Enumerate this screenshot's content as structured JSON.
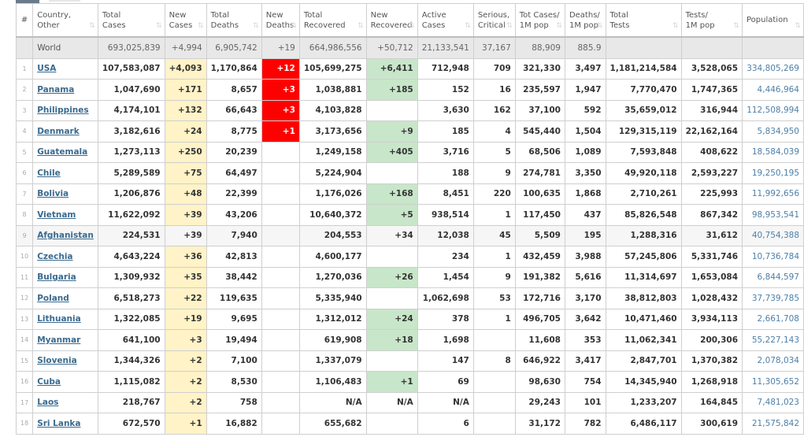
{
  "table": {
    "headers": [
      {
        "line1": "#",
        "line2": ""
      },
      {
        "line1": "Country,",
        "line2": "Other"
      },
      {
        "line1": "Total",
        "line2": "Cases"
      },
      {
        "line1": "New",
        "line2": "Cases"
      },
      {
        "line1": "Total",
        "line2": "Deaths"
      },
      {
        "line1": "New",
        "line2": "Deaths"
      },
      {
        "line1": "Total",
        "line2": "Recovered"
      },
      {
        "line1": "New",
        "line2": "Recovered"
      },
      {
        "line1": "Active",
        "line2": "Cases"
      },
      {
        "line1": "Serious,",
        "line2": "Critical"
      },
      {
        "line1": "Tot Cases/",
        "line2": "1M pop"
      },
      {
        "line1": "Deaths/",
        "line2": "1M pop"
      },
      {
        "line1": "Total",
        "line2": "Tests"
      },
      {
        "line1": "Tests/",
        "line2": "1M pop"
      },
      {
        "line1": "",
        "line2": "Population"
      }
    ],
    "sort_icon": "⇅",
    "world": {
      "country": "World",
      "total_cases": "693,025,839",
      "new_cases": "+4,994",
      "total_deaths": "6,905,742",
      "new_deaths": "+19",
      "total_recovered": "664,986,556",
      "new_recovered": "+50,712",
      "active_cases": "21,133,541",
      "serious": "37,167",
      "cases_per_m": "88,909",
      "deaths_per_m": "885.9",
      "total_tests": "",
      "tests_per_m": "",
      "population": ""
    },
    "rows": [
      {
        "idx": "1",
        "country": "USA",
        "total_cases": "107,583,087",
        "new_cases": "+4,093",
        "total_deaths": "1,170,864",
        "new_deaths": "+12",
        "total_recovered": "105,699,275",
        "new_recovered": "+6,411",
        "active_cases": "712,948",
        "serious": "709",
        "cases_per_m": "321,330",
        "deaths_per_m": "3,497",
        "total_tests": "1,181,214,584",
        "tests_per_m": "3,528,065",
        "population": "334,805,269"
      },
      {
        "idx": "2",
        "country": "Panama",
        "total_cases": "1,047,690",
        "new_cases": "+171",
        "total_deaths": "8,657",
        "new_deaths": "+3",
        "total_recovered": "1,038,881",
        "new_recovered": "+185",
        "active_cases": "152",
        "serious": "16",
        "cases_per_m": "235,597",
        "deaths_per_m": "1,947",
        "total_tests": "7,770,470",
        "tests_per_m": "1,747,365",
        "population": "4,446,964"
      },
      {
        "idx": "3",
        "country": "Philippines",
        "total_cases": "4,174,101",
        "new_cases": "+132",
        "total_deaths": "66,643",
        "new_deaths": "+3",
        "total_recovered": "4,103,828",
        "new_recovered": "",
        "active_cases": "3,630",
        "serious": "162",
        "cases_per_m": "37,100",
        "deaths_per_m": "592",
        "total_tests": "35,659,012",
        "tests_per_m": "316,944",
        "population": "112,508,994"
      },
      {
        "idx": "4",
        "country": "Denmark",
        "total_cases": "3,182,616",
        "new_cases": "+24",
        "total_deaths": "8,775",
        "new_deaths": "+1",
        "total_recovered": "3,173,656",
        "new_recovered": "+9",
        "active_cases": "185",
        "serious": "4",
        "cases_per_m": "545,440",
        "deaths_per_m": "1,504",
        "total_tests": "129,315,119",
        "tests_per_m": "22,162,164",
        "population": "5,834,950"
      },
      {
        "idx": "5",
        "country": "Guatemala",
        "total_cases": "1,273,113",
        "new_cases": "+250",
        "total_deaths": "20,239",
        "new_deaths": "",
        "total_recovered": "1,249,158",
        "new_recovered": "+405",
        "active_cases": "3,716",
        "serious": "5",
        "cases_per_m": "68,506",
        "deaths_per_m": "1,089",
        "total_tests": "7,593,848",
        "tests_per_m": "408,622",
        "population": "18,584,039"
      },
      {
        "idx": "6",
        "country": "Chile",
        "total_cases": "5,289,589",
        "new_cases": "+75",
        "total_deaths": "64,497",
        "new_deaths": "",
        "total_recovered": "5,224,904",
        "new_recovered": "",
        "active_cases": "188",
        "serious": "9",
        "cases_per_m": "274,781",
        "deaths_per_m": "3,350",
        "total_tests": "49,920,118",
        "tests_per_m": "2,593,227",
        "population": "19,250,195"
      },
      {
        "idx": "7",
        "country": "Bolivia",
        "total_cases": "1,206,876",
        "new_cases": "+48",
        "total_deaths": "22,399",
        "new_deaths": "",
        "total_recovered": "1,176,026",
        "new_recovered": "+168",
        "active_cases": "8,451",
        "serious": "220",
        "cases_per_m": "100,635",
        "deaths_per_m": "1,868",
        "total_tests": "2,710,261",
        "tests_per_m": "225,993",
        "population": "11,992,656"
      },
      {
        "idx": "8",
        "country": "Vietnam",
        "total_cases": "11,622,092",
        "new_cases": "+39",
        "total_deaths": "43,206",
        "new_deaths": "",
        "total_recovered": "10,640,372",
        "new_recovered": "+5",
        "active_cases": "938,514",
        "serious": "1",
        "cases_per_m": "117,450",
        "deaths_per_m": "437",
        "total_tests": "85,826,548",
        "tests_per_m": "867,342",
        "population": "98,953,541"
      },
      {
        "idx": "9",
        "country": "Afghanistan",
        "total_cases": "224,531",
        "new_cases": "+39",
        "total_deaths": "7,940",
        "new_deaths": "",
        "total_recovered": "204,553",
        "new_recovered": "+34",
        "active_cases": "12,038",
        "serious": "45",
        "cases_per_m": "5,509",
        "deaths_per_m": "195",
        "total_tests": "1,288,316",
        "tests_per_m": "31,612",
        "population": "40,754,388"
      },
      {
        "idx": "10",
        "country": "Czechia",
        "total_cases": "4,643,224",
        "new_cases": "+36",
        "total_deaths": "42,813",
        "new_deaths": "",
        "total_recovered": "4,600,177",
        "new_recovered": "",
        "active_cases": "234",
        "serious": "1",
        "cases_per_m": "432,459",
        "deaths_per_m": "3,988",
        "total_tests": "57,245,806",
        "tests_per_m": "5,331,746",
        "population": "10,736,784"
      },
      {
        "idx": "11",
        "country": "Bulgaria",
        "total_cases": "1,309,932",
        "new_cases": "+35",
        "total_deaths": "38,442",
        "new_deaths": "",
        "total_recovered": "1,270,036",
        "new_recovered": "+26",
        "active_cases": "1,454",
        "serious": "9",
        "cases_per_m": "191,382",
        "deaths_per_m": "5,616",
        "total_tests": "11,314,697",
        "tests_per_m": "1,653,084",
        "population": "6,844,597"
      },
      {
        "idx": "12",
        "country": "Poland",
        "total_cases": "6,518,273",
        "new_cases": "+22",
        "total_deaths": "119,635",
        "new_deaths": "",
        "total_recovered": "5,335,940",
        "new_recovered": "",
        "active_cases": "1,062,698",
        "serious": "53",
        "cases_per_m": "172,716",
        "deaths_per_m": "3,170",
        "total_tests": "38,812,803",
        "tests_per_m": "1,028,432",
        "population": "37,739,785"
      },
      {
        "idx": "13",
        "country": "Lithuania",
        "total_cases": "1,322,085",
        "new_cases": "+19",
        "total_deaths": "9,695",
        "new_deaths": "",
        "total_recovered": "1,312,012",
        "new_recovered": "+24",
        "active_cases": "378",
        "serious": "1",
        "cases_per_m": "496,705",
        "deaths_per_m": "3,642",
        "total_tests": "10,471,460",
        "tests_per_m": "3,934,113",
        "population": "2,661,708"
      },
      {
        "idx": "14",
        "country": "Myanmar",
        "total_cases": "641,100",
        "new_cases": "+3",
        "total_deaths": "19,494",
        "new_deaths": "",
        "total_recovered": "619,908",
        "new_recovered": "+18",
        "active_cases": "1,698",
        "serious": "",
        "cases_per_m": "11,608",
        "deaths_per_m": "353",
        "total_tests": "11,062,341",
        "tests_per_m": "200,306",
        "population": "55,227,143"
      },
      {
        "idx": "15",
        "country": "Slovenia",
        "total_cases": "1,344,326",
        "new_cases": "+2",
        "total_deaths": "7,100",
        "new_deaths": "",
        "total_recovered": "1,337,079",
        "new_recovered": "",
        "active_cases": "147",
        "serious": "8",
        "cases_per_m": "646,922",
        "deaths_per_m": "3,417",
        "total_tests": "2,847,701",
        "tests_per_m": "1,370,382",
        "population": "2,078,034"
      },
      {
        "idx": "16",
        "country": "Cuba",
        "total_cases": "1,115,082",
        "new_cases": "+2",
        "total_deaths": "8,530",
        "new_deaths": "",
        "total_recovered": "1,106,483",
        "new_recovered": "+1",
        "active_cases": "69",
        "serious": "",
        "cases_per_m": "98,630",
        "deaths_per_m": "754",
        "total_tests": "14,345,940",
        "tests_per_m": "1,268,918",
        "population": "11,305,652"
      },
      {
        "idx": "17",
        "country": "Laos",
        "total_cases": "218,767",
        "new_cases": "+2",
        "total_deaths": "758",
        "new_deaths": "",
        "total_recovered": "N/A",
        "new_recovered": "N/A",
        "active_cases": "N/A",
        "serious": "",
        "cases_per_m": "29,243",
        "deaths_per_m": "101",
        "total_tests": "1,233,207",
        "tests_per_m": "164,845",
        "population": "7,481,023"
      },
      {
        "idx": "18",
        "country": "Sri Lanka",
        "total_cases": "672,570",
        "new_cases": "+1",
        "total_deaths": "16,882",
        "new_deaths": "",
        "total_recovered": "655,682",
        "new_recovered": "",
        "active_cases": "6",
        "serious": "",
        "cases_per_m": "31,172",
        "deaths_per_m": "782",
        "total_tests": "6,486,117",
        "tests_per_m": "300,619",
        "population": "21,575,842"
      }
    ]
  }
}
